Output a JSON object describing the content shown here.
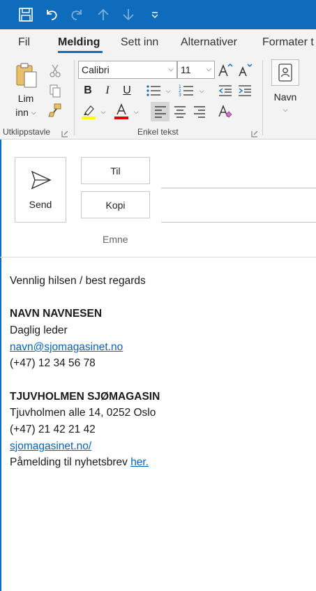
{
  "titlebar": {
    "quick_access": [
      {
        "icon": "save-icon"
      },
      {
        "icon": "undo-icon"
      },
      {
        "icon": "redo-icon"
      },
      {
        "icon": "arrow-up-icon"
      },
      {
        "icon": "arrow-down-icon"
      },
      {
        "icon": "customize-toolbar-icon"
      }
    ],
    "accent": "#0f6cbd"
  },
  "tabs": [
    {
      "label": "Fil",
      "active": false
    },
    {
      "label": "Melding",
      "active": true
    },
    {
      "label": "Sett inn",
      "active": false
    },
    {
      "label": "Alternativer",
      "active": false
    },
    {
      "label": "Formater t",
      "active": false
    }
  ],
  "ribbon": {
    "clipboard": {
      "paste_label_line1": "Lim",
      "paste_label_line2": "inn",
      "group_label": "Utklippstavle"
    },
    "basic_text": {
      "font_name": "Calibri",
      "font_size": "11",
      "group_label": "Enkel tekst",
      "highlight_color": "#ffff00",
      "font_color": "#e00000"
    },
    "names": {
      "label": "Navn"
    }
  },
  "compose": {
    "send_label": "Send",
    "to_label": "Til",
    "cc_label": "Kopi",
    "subject_label": "Emne"
  },
  "body": {
    "greeting": "Vennlig hilsen / best regards",
    "name": "NAVN NAVNESEN",
    "title": "Daglig leder",
    "email": "navn@sjomagasinet.no",
    "phone": "(+47) 12 34 56 78",
    "company": "TJUVHOLMEN SJØMAGASIN",
    "address": "Tjuvholmen alle 14, 0252 Oslo",
    "company_phone": "(+47) 21 42 21 42",
    "website": "sjomagasinet.no/",
    "newsletter_text": "Påmelding til nyhetsbrev",
    "newsletter_link": "her."
  }
}
